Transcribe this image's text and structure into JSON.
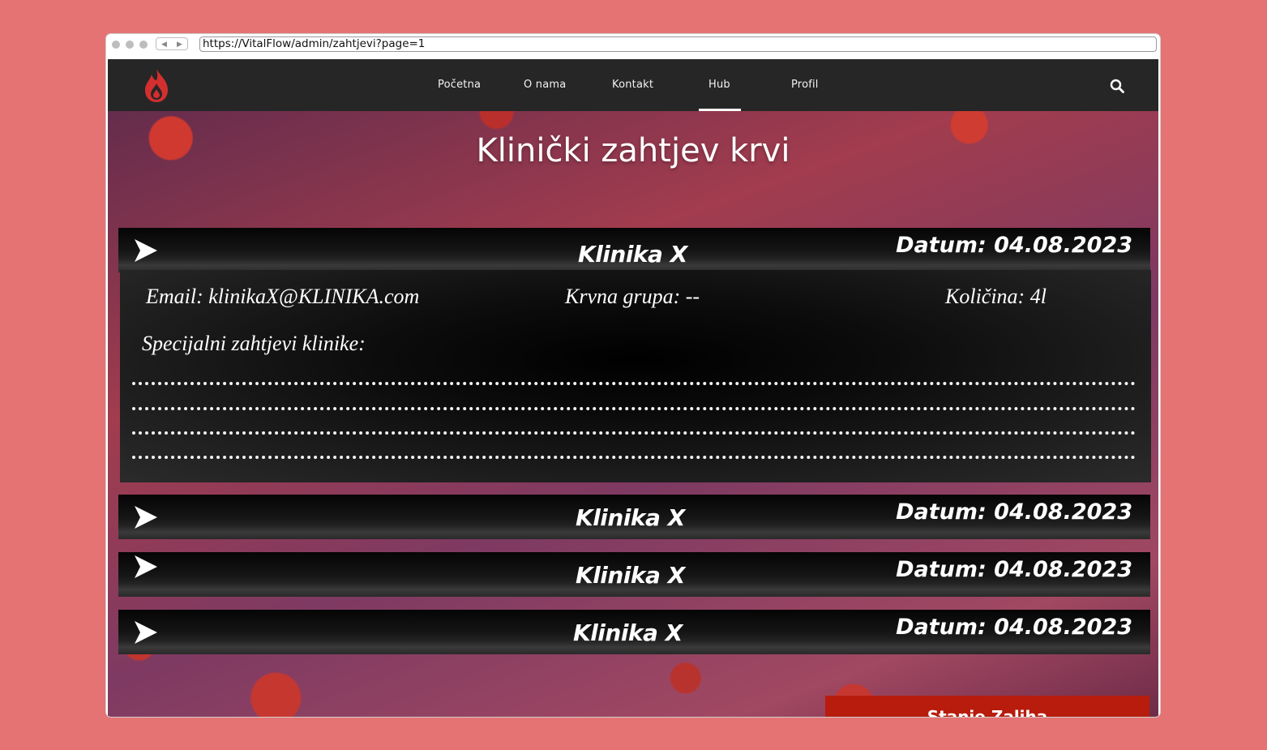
{
  "browser": {
    "url": "https://VitalFlow/admin/zahtjevi?page=1"
  },
  "nav": {
    "items": [
      {
        "label": "Početna"
      },
      {
        "label": "O nama"
      },
      {
        "label": "Kontakt"
      },
      {
        "label": "Hub"
      },
      {
        "label": "Profil"
      }
    ],
    "active": "Hub"
  },
  "page": {
    "title": "Klinički zahtjev krvi"
  },
  "requests": [
    {
      "clinic": "Klinika X",
      "date": "Datum: 04.08.2023",
      "expanded": true
    },
    {
      "clinic": "Klinika X",
      "date": "Datum: 04.08.2023",
      "expanded": false
    },
    {
      "clinic": "Klinika X",
      "date": "Datum: 04.08.2023",
      "expanded": false
    },
    {
      "clinic": "Klinika X",
      "date": "Datum: 04.08.2023",
      "expanded": false
    }
  ],
  "detail": {
    "email": "Email: klinikaX@KLINIKA.com",
    "blood_group": "Krvna grupa: --",
    "quantity": "Količina: 4l",
    "special_label": "Specijalni zahtjevi klinike:"
  },
  "actions": {
    "stock_label": "Stanje Zaliha"
  },
  "colors": {
    "page_bg": "#e57373",
    "nav_bg": "#262626",
    "accent_red": "#b71c0c",
    "logo_red": "#d32f2f"
  },
  "icons": {
    "logo": "blood-drop-flame-icon",
    "search": "search-icon",
    "expand": "chevron-right-arrow-icon"
  }
}
